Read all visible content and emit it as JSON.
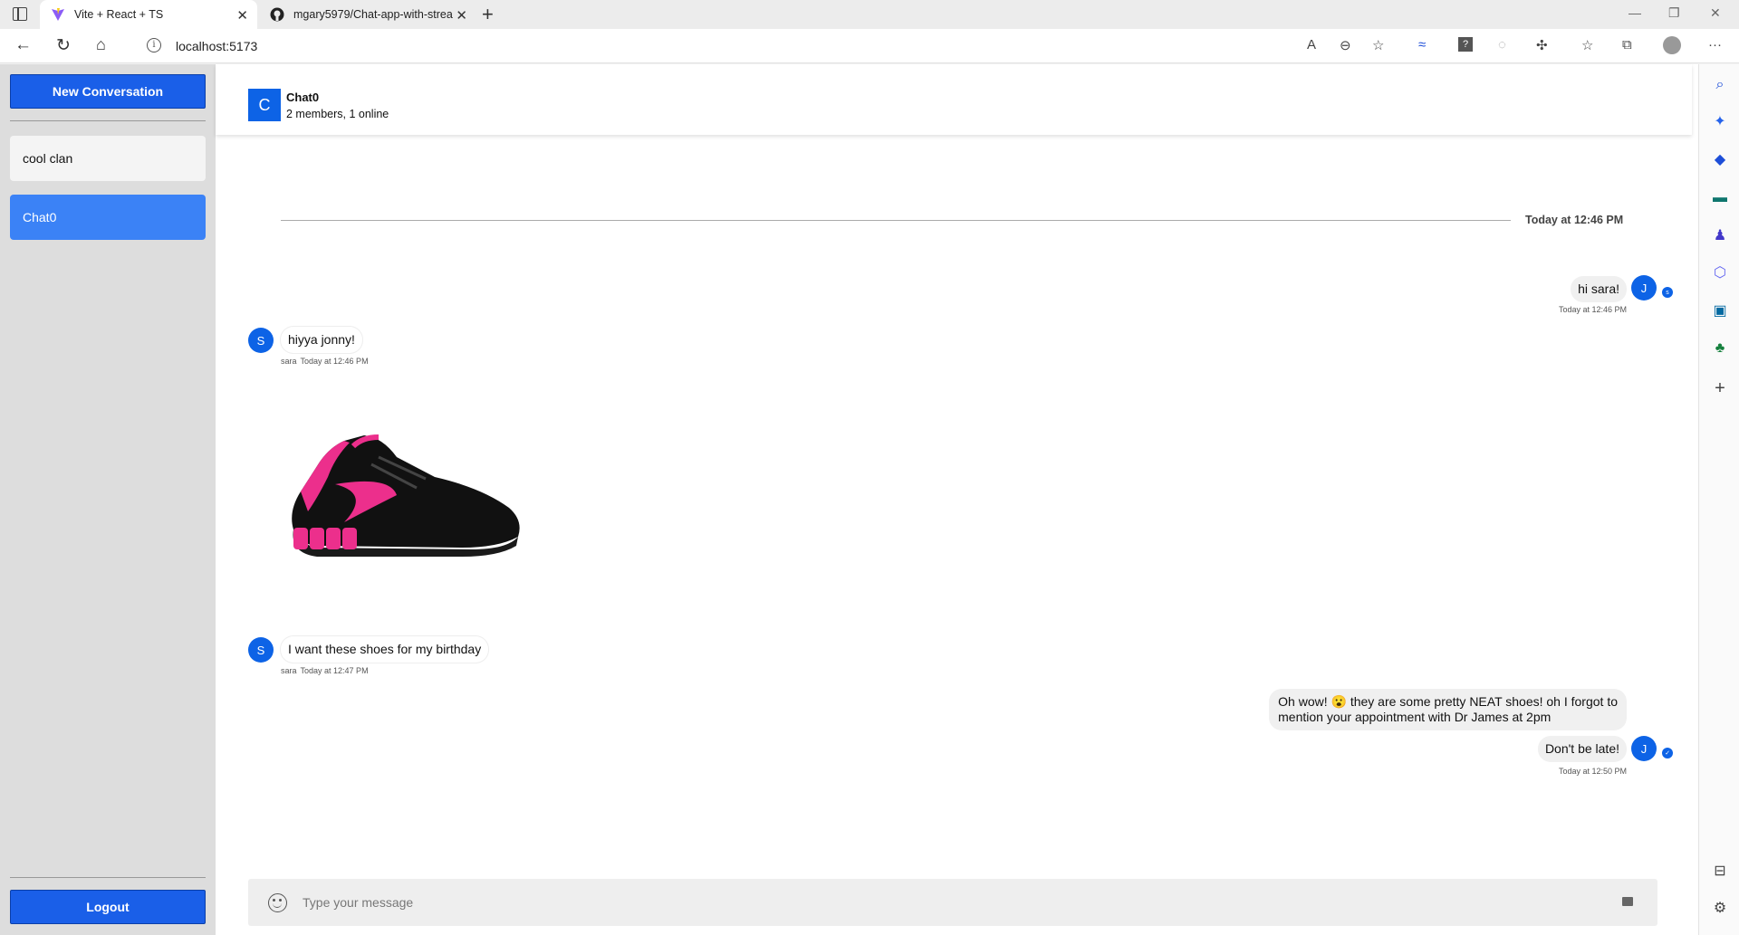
{
  "browser": {
    "tabs": [
      {
        "title": "Vite + React + TS",
        "icon": "vite-icon",
        "active": true
      },
      {
        "title": "mgary5979/Chat-app-with-strea",
        "icon": "github-icon",
        "active": false
      }
    ],
    "url": "localhost:5173"
  },
  "sidebar": {
    "new_conversation_label": "New Conversation",
    "conversations": [
      {
        "name": "cool clan",
        "selected": false
      },
      {
        "name": "Chat0",
        "selected": true
      }
    ],
    "logout_label": "Logout"
  },
  "chat_header": {
    "avatar_letter": "C",
    "title": "Chat0",
    "subtitle": "2 members, 1 online"
  },
  "date_separator": "Today at 12:46 PM",
  "messages": {
    "m1": {
      "avatar": "J",
      "text": "hi sara!",
      "time": "Today at 12:46 PM",
      "read_avatar": "s"
    },
    "m2": {
      "avatar": "S",
      "text": "hiyya jonny!",
      "author": "sara",
      "time": "Today at 12:46 PM"
    },
    "m3": {
      "avatar": "S",
      "text": "I want these shoes for my birthday",
      "author": "sara",
      "time": "Today at 12:47 PM"
    },
    "m4": {
      "text_line1": "Oh wow! 😮 they are some pretty NEAT shoes! oh I forgot to",
      "text_line2": "mention your appointment with Dr James at 2pm"
    },
    "m5": {
      "avatar": "J",
      "text": "Don't be late!",
      "time": "Today at 12:50 PM",
      "status": "delivered"
    }
  },
  "composer": {
    "placeholder": "Type your message"
  },
  "colors": {
    "primary": "#1a5fe8",
    "selected_conversation": "#3b82f6",
    "avatar": "#0d63e6",
    "sidebar_bg": "#dddddd"
  }
}
